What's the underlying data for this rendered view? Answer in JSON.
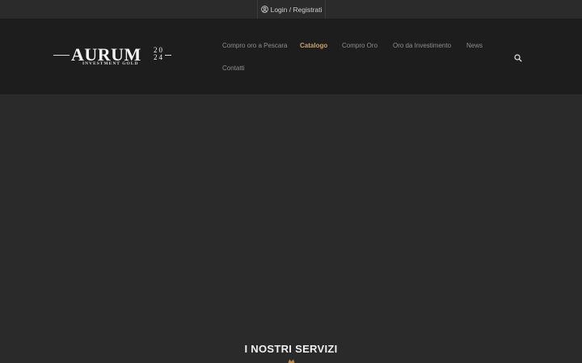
{
  "topbar": {
    "login_label": "Login / Registrati",
    "login_icon": "user-circle-icon"
  },
  "logo": {
    "word": "AURUM",
    "year_top": "20",
    "year_bottom": "24",
    "subtitle": "INVESTMENT GOLD"
  },
  "nav": {
    "items": [
      {
        "label": "Compro oro a Pescara",
        "active": false
      },
      {
        "label": "Catalogo",
        "active": true
      },
      {
        "label": "Compro Oro",
        "active": false
      },
      {
        "label": "Oro da Investimento",
        "active": false
      },
      {
        "label": "News",
        "active": false
      },
      {
        "label": "Contatti",
        "active": false
      }
    ],
    "search_icon": "search-icon"
  },
  "services": {
    "title": "I NOSTRI SERVIZI",
    "ornament_icon": "ornament-icon"
  },
  "colors": {
    "background": "#2a2a2a",
    "header": "#1d1d1d",
    "accent": "#c9a36a",
    "nav_text": "#8e8e8e"
  }
}
